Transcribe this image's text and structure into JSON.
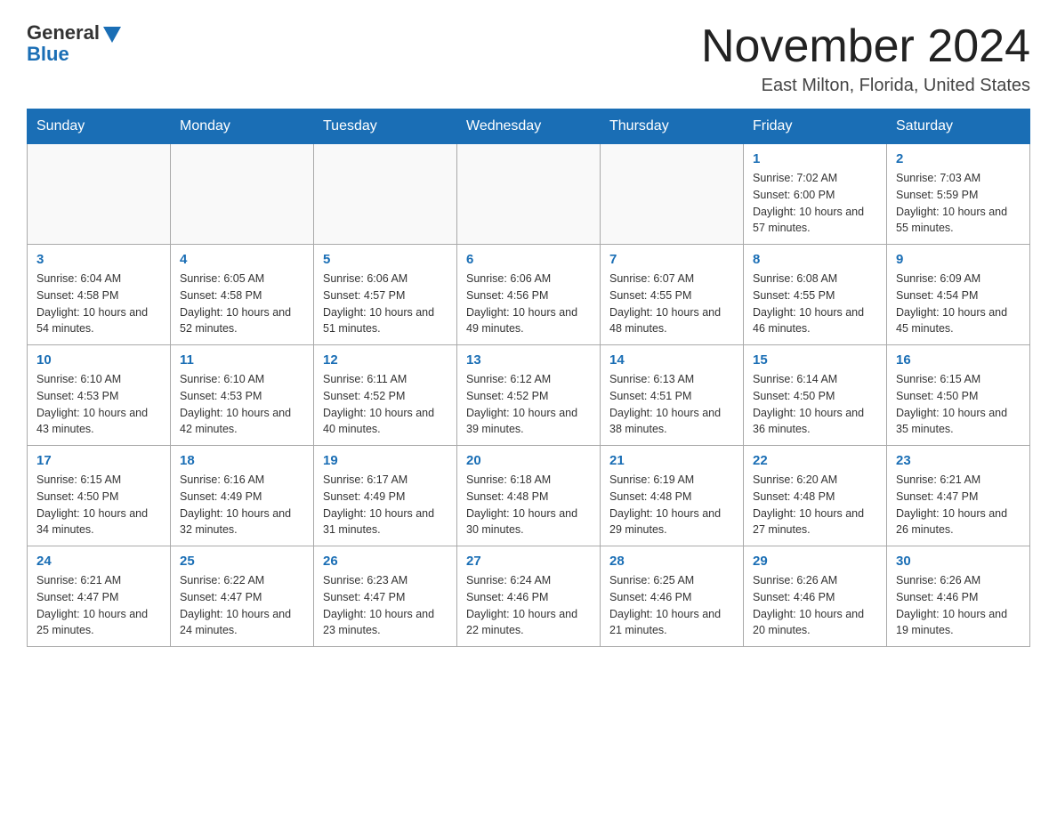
{
  "logo": {
    "general_text": "General",
    "blue_text": "Blue"
  },
  "title": "November 2024",
  "location": "East Milton, Florida, United States",
  "days_of_week": [
    "Sunday",
    "Monday",
    "Tuesday",
    "Wednesday",
    "Thursday",
    "Friday",
    "Saturday"
  ],
  "weeks": [
    [
      {
        "day": "",
        "info": ""
      },
      {
        "day": "",
        "info": ""
      },
      {
        "day": "",
        "info": ""
      },
      {
        "day": "",
        "info": ""
      },
      {
        "day": "",
        "info": ""
      },
      {
        "day": "1",
        "info": "Sunrise: 7:02 AM\nSunset: 6:00 PM\nDaylight: 10 hours and 57 minutes."
      },
      {
        "day": "2",
        "info": "Sunrise: 7:03 AM\nSunset: 5:59 PM\nDaylight: 10 hours and 55 minutes."
      }
    ],
    [
      {
        "day": "3",
        "info": "Sunrise: 6:04 AM\nSunset: 4:58 PM\nDaylight: 10 hours and 54 minutes."
      },
      {
        "day": "4",
        "info": "Sunrise: 6:05 AM\nSunset: 4:58 PM\nDaylight: 10 hours and 52 minutes."
      },
      {
        "day": "5",
        "info": "Sunrise: 6:06 AM\nSunset: 4:57 PM\nDaylight: 10 hours and 51 minutes."
      },
      {
        "day": "6",
        "info": "Sunrise: 6:06 AM\nSunset: 4:56 PM\nDaylight: 10 hours and 49 minutes."
      },
      {
        "day": "7",
        "info": "Sunrise: 6:07 AM\nSunset: 4:55 PM\nDaylight: 10 hours and 48 minutes."
      },
      {
        "day": "8",
        "info": "Sunrise: 6:08 AM\nSunset: 4:55 PM\nDaylight: 10 hours and 46 minutes."
      },
      {
        "day": "9",
        "info": "Sunrise: 6:09 AM\nSunset: 4:54 PM\nDaylight: 10 hours and 45 minutes."
      }
    ],
    [
      {
        "day": "10",
        "info": "Sunrise: 6:10 AM\nSunset: 4:53 PM\nDaylight: 10 hours and 43 minutes."
      },
      {
        "day": "11",
        "info": "Sunrise: 6:10 AM\nSunset: 4:53 PM\nDaylight: 10 hours and 42 minutes."
      },
      {
        "day": "12",
        "info": "Sunrise: 6:11 AM\nSunset: 4:52 PM\nDaylight: 10 hours and 40 minutes."
      },
      {
        "day": "13",
        "info": "Sunrise: 6:12 AM\nSunset: 4:52 PM\nDaylight: 10 hours and 39 minutes."
      },
      {
        "day": "14",
        "info": "Sunrise: 6:13 AM\nSunset: 4:51 PM\nDaylight: 10 hours and 38 minutes."
      },
      {
        "day": "15",
        "info": "Sunrise: 6:14 AM\nSunset: 4:50 PM\nDaylight: 10 hours and 36 minutes."
      },
      {
        "day": "16",
        "info": "Sunrise: 6:15 AM\nSunset: 4:50 PM\nDaylight: 10 hours and 35 minutes."
      }
    ],
    [
      {
        "day": "17",
        "info": "Sunrise: 6:15 AM\nSunset: 4:50 PM\nDaylight: 10 hours and 34 minutes."
      },
      {
        "day": "18",
        "info": "Sunrise: 6:16 AM\nSunset: 4:49 PM\nDaylight: 10 hours and 32 minutes."
      },
      {
        "day": "19",
        "info": "Sunrise: 6:17 AM\nSunset: 4:49 PM\nDaylight: 10 hours and 31 minutes."
      },
      {
        "day": "20",
        "info": "Sunrise: 6:18 AM\nSunset: 4:48 PM\nDaylight: 10 hours and 30 minutes."
      },
      {
        "day": "21",
        "info": "Sunrise: 6:19 AM\nSunset: 4:48 PM\nDaylight: 10 hours and 29 minutes."
      },
      {
        "day": "22",
        "info": "Sunrise: 6:20 AM\nSunset: 4:48 PM\nDaylight: 10 hours and 27 minutes."
      },
      {
        "day": "23",
        "info": "Sunrise: 6:21 AM\nSunset: 4:47 PM\nDaylight: 10 hours and 26 minutes."
      }
    ],
    [
      {
        "day": "24",
        "info": "Sunrise: 6:21 AM\nSunset: 4:47 PM\nDaylight: 10 hours and 25 minutes."
      },
      {
        "day": "25",
        "info": "Sunrise: 6:22 AM\nSunset: 4:47 PM\nDaylight: 10 hours and 24 minutes."
      },
      {
        "day": "26",
        "info": "Sunrise: 6:23 AM\nSunset: 4:47 PM\nDaylight: 10 hours and 23 minutes."
      },
      {
        "day": "27",
        "info": "Sunrise: 6:24 AM\nSunset: 4:46 PM\nDaylight: 10 hours and 22 minutes."
      },
      {
        "day": "28",
        "info": "Sunrise: 6:25 AM\nSunset: 4:46 PM\nDaylight: 10 hours and 21 minutes."
      },
      {
        "day": "29",
        "info": "Sunrise: 6:26 AM\nSunset: 4:46 PM\nDaylight: 10 hours and 20 minutes."
      },
      {
        "day": "30",
        "info": "Sunrise: 6:26 AM\nSunset: 4:46 PM\nDaylight: 10 hours and 19 minutes."
      }
    ]
  ]
}
